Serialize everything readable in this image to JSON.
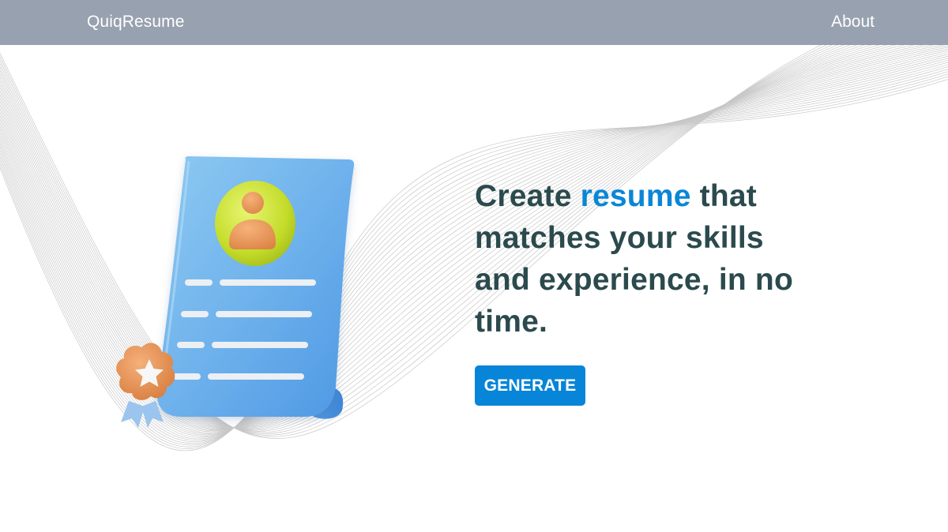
{
  "navbar": {
    "brand": "QuiqResume",
    "about_link": "About"
  },
  "hero": {
    "headline_before": "Create ",
    "headline_accent": "resume",
    "headline_after": " that matches your skills and experience, in no time.",
    "generate_button": "GENERATE"
  },
  "illustration": {
    "icons": [
      "resume-document-icon",
      "user-avatar-icon",
      "award-badge-icon",
      "star-icon"
    ]
  },
  "colors": {
    "navbar_bg": "#98a1b0",
    "headline_text": "#2b4a4d",
    "accent": "#0a86d6",
    "button_bg": "#0785d8",
    "wave_lines": "#b5b5b5"
  }
}
